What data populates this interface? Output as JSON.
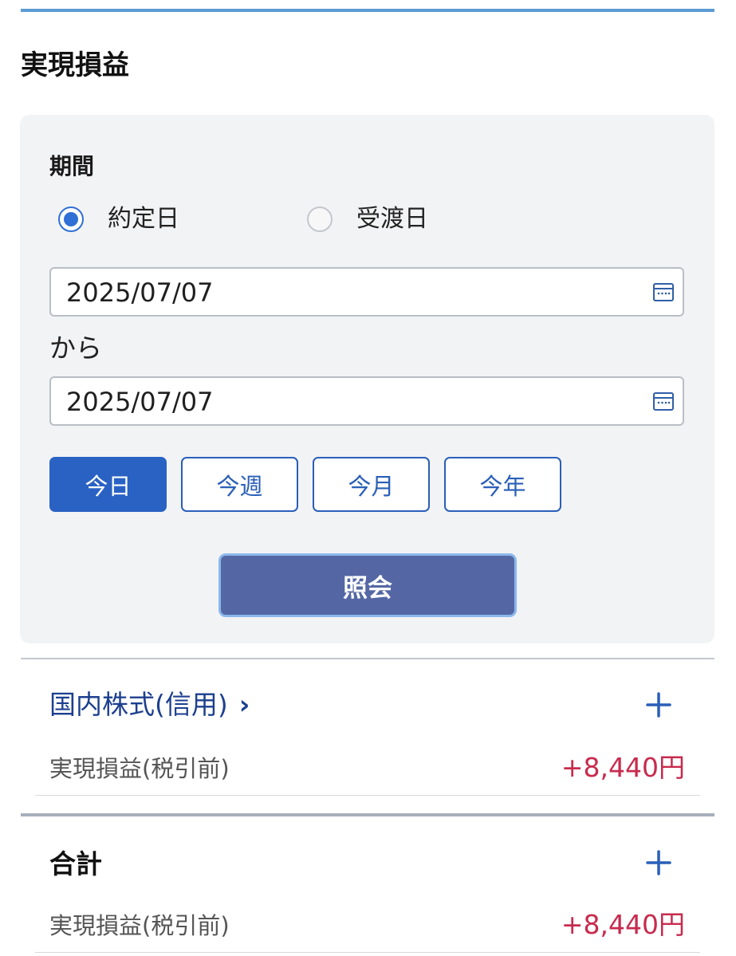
{
  "page": {
    "title": "実現損益"
  },
  "filter": {
    "period_label": "期間",
    "radio_options": [
      {
        "label": "約定日",
        "checked": true
      },
      {
        "label": "受渡日",
        "checked": false
      }
    ],
    "start_date": "2025/07/07",
    "separator": "から",
    "end_date": "2025/07/07",
    "range_buttons": [
      {
        "label": "今日",
        "active": true
      },
      {
        "label": "今週",
        "active": false
      },
      {
        "label": "今月",
        "active": false
      },
      {
        "label": "今年",
        "active": false
      }
    ],
    "submit_label": "照会"
  },
  "sections": [
    {
      "title": "国内株式(信用)",
      "chevron": "›",
      "row_label": "実現損益(税引前)",
      "row_value": "+8,440円"
    },
    {
      "title": "合計",
      "row_label": "実現損益(税引前)",
      "row_value": "+8,440円"
    }
  ],
  "colors": {
    "accent": "#2a62c4",
    "link": "#1c3f8f",
    "profit": "#c72b4e",
    "submit": "#5467a4"
  },
  "icons": {
    "calendar": "calendar-icon",
    "expand": "plus-icon",
    "chevron": "chevron-right-icon"
  }
}
